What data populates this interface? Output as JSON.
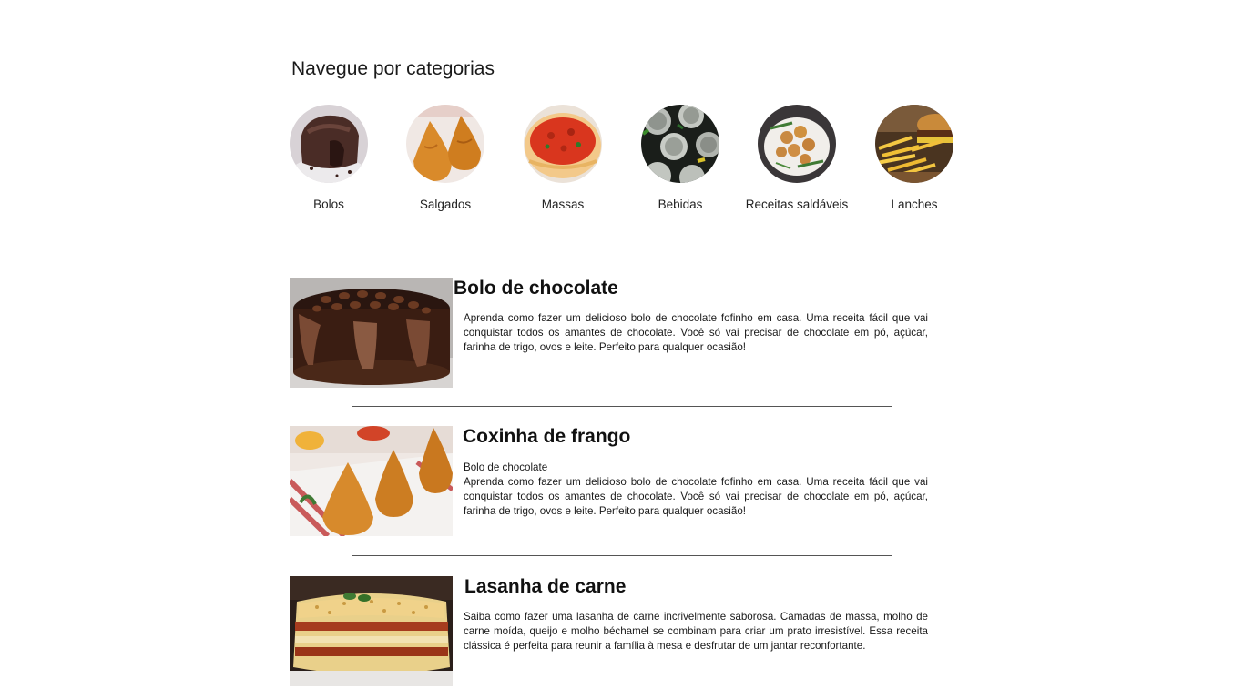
{
  "categories_section": {
    "title": "Navegue por categorias",
    "items": [
      {
        "label": "Bolos",
        "icon": "chocolate-lava-cake-image"
      },
      {
        "label": "Salgados",
        "icon": "coxinha-image"
      },
      {
        "label": "Massas",
        "icon": "spaghetti-image"
      },
      {
        "label": "Bebidas",
        "icon": "soda-cans-image"
      },
      {
        "label": "Receitas saldáveis",
        "icon": "healthy-meatballs-image"
      },
      {
        "label": "Lanches",
        "icon": "burger-fries-image"
      }
    ]
  },
  "recipes": [
    {
      "title": "Bolo de chocolate",
      "subtitle": "",
      "description": "Aprenda como fazer um delicioso bolo de chocolate fofinho em casa. Uma receita fácil que vai conquistar todos os amantes de chocolate. Você só vai precisar de chocolate em pó, açúcar, farinha de trigo, ovos e leite. Perfeito para qualquer ocasião!",
      "image": "chocolate-cake-image"
    },
    {
      "title": "Coxinha de frango",
      "subtitle": "Bolo de chocolate",
      "description": "Aprenda como fazer um delicioso bolo de chocolate fofinho em casa. Uma receita fácil que vai conquistar todos os amantes de chocolate. Você só vai precisar de chocolate em pó, açúcar, farinha de trigo, ovos e leite. Perfeito para qualquer ocasião!",
      "image": "coxinha-image"
    },
    {
      "title": "Lasanha de carne",
      "subtitle": "",
      "description": "Saiba como fazer uma lasanha de carne incrivelmente saborosa. Camadas de massa, molho de carne moída, queijo e molho béchamel se combinam para criar um prato irresistível. Essa receita clássica é perfeita para reunir a família à mesa e desfrutar de um jantar reconfortante.",
      "image": "lasagna-image"
    }
  ]
}
